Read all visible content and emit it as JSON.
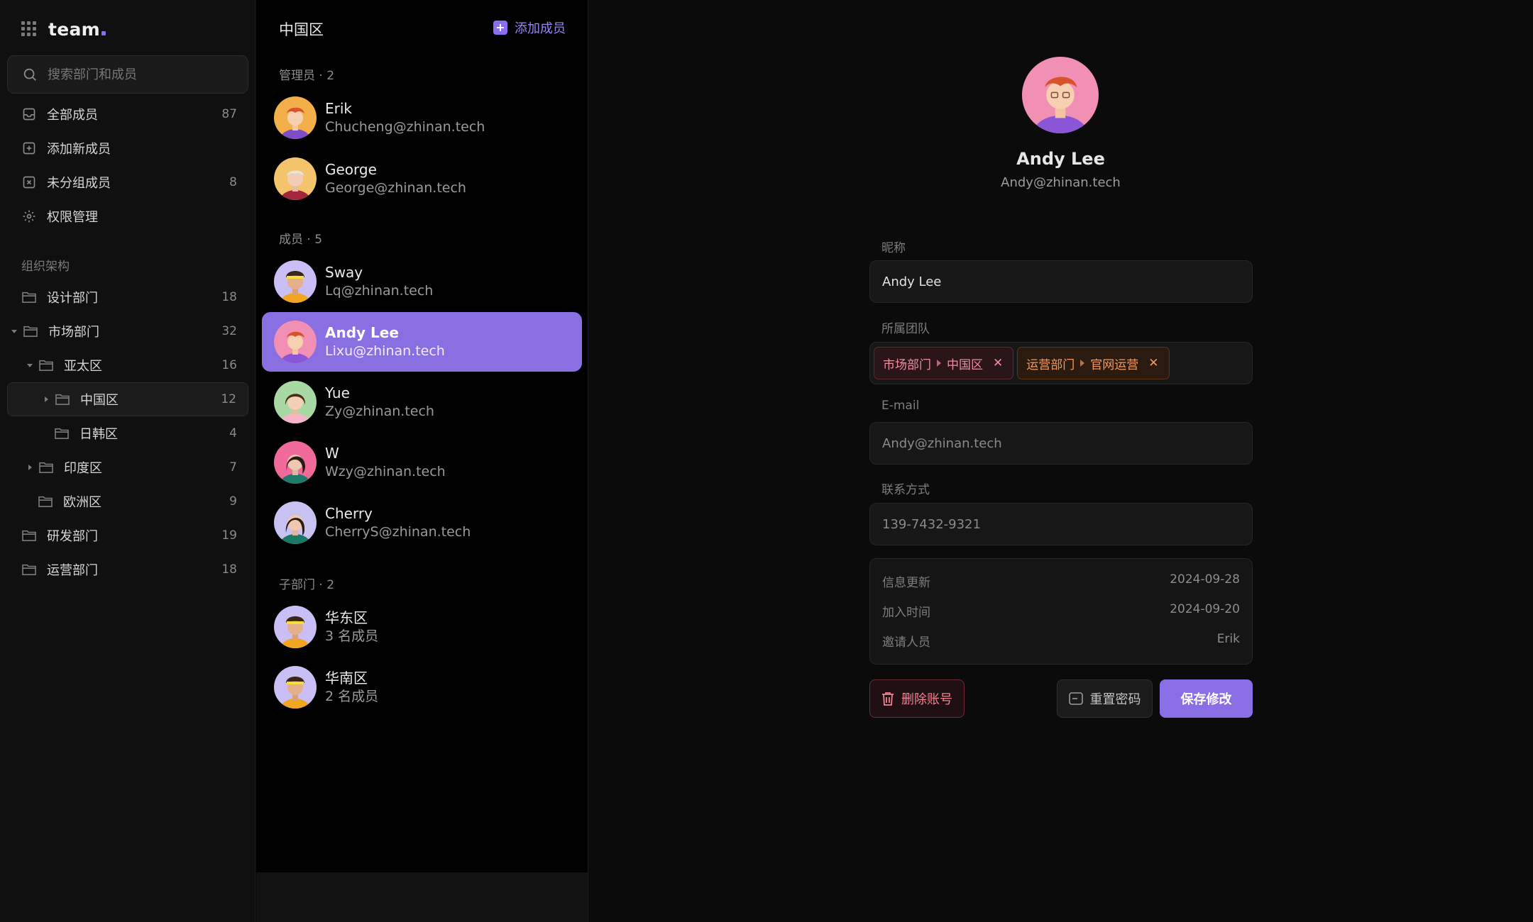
{
  "app": {
    "brand": "team"
  },
  "sidebar": {
    "search_placeholder": "搜索部门和成员",
    "nav": [
      {
        "label": "全部成员",
        "count": "87",
        "icon": "inbox-icon"
      },
      {
        "label": "添加新成员",
        "count": "",
        "icon": "plus-square-icon"
      },
      {
        "label": "未分组成员",
        "count": "8",
        "icon": "x-square-icon"
      },
      {
        "label": "权限管理",
        "count": "",
        "icon": "gear-icon"
      }
    ],
    "section_label": "组织架构",
    "tree": [
      {
        "label": "设计部门",
        "count": "18"
      },
      {
        "label": "市场部门",
        "count": "32"
      },
      {
        "label": "亚太区",
        "count": "16"
      },
      {
        "label": "中国区",
        "count": "12"
      },
      {
        "label": "日韩区",
        "count": "4"
      },
      {
        "label": "印度区",
        "count": "7"
      },
      {
        "label": "欧洲区",
        "count": "9"
      },
      {
        "label": "研发部门",
        "count": "19"
      },
      {
        "label": "运营部门",
        "count": "18"
      }
    ]
  },
  "list": {
    "title": "中国区",
    "add_label": "添加成员",
    "groups": [
      {
        "label": "管理员 · 2"
      },
      {
        "label": "成员 · 5"
      },
      {
        "label": "子部门 · 2"
      }
    ],
    "members": [
      {
        "name": "Erik",
        "email": "Chucheng@zhinan.tech"
      },
      {
        "name": "George",
        "email": "George@zhinan.tech"
      },
      {
        "name": "Sway",
        "email": "Lq@zhinan.tech"
      },
      {
        "name": "Andy Lee",
        "email": "Lixu@zhinan.tech"
      },
      {
        "name": "Yue",
        "email": "Zy@zhinan.tech"
      },
      {
        "name": "W",
        "email": "Wzy@zhinan.tech"
      },
      {
        "name": "Cherry",
        "email": "CherryS@zhinan.tech"
      }
    ],
    "subdepts": [
      {
        "name": "华东区",
        "sub": "3 名成员"
      },
      {
        "name": "华南区",
        "sub": "2 名成员"
      }
    ]
  },
  "detail": {
    "name": "Andy Lee",
    "email": "Andy@zhinan.tech",
    "nickname_label": "昵称",
    "nickname_value": "Andy Lee",
    "team_label": "所属团队",
    "teams": [
      {
        "dept": "市场部门",
        "sub": "中国区",
        "color": "#f08da0"
      },
      {
        "dept": "运营部门",
        "sub": "官网运营",
        "color": "#f49a5c"
      }
    ],
    "email_label": "E-mail",
    "email_value": "Andy@zhinan.tech",
    "phone_label": "联系方式",
    "phone_value": "139-7432-9321",
    "info": [
      {
        "k": "信息更新",
        "v": "2024-09-28"
      },
      {
        "k": "加入时间",
        "v": "2024-09-20"
      },
      {
        "k": "邀请人员",
        "v": "Erik"
      }
    ],
    "delete_label": "删除账号",
    "reset_label": "重置密码",
    "save_label": "保存修改"
  },
  "colors": {
    "accent": "#8a6df0",
    "selected": "#8a6fe2",
    "danger": "#f08391"
  }
}
